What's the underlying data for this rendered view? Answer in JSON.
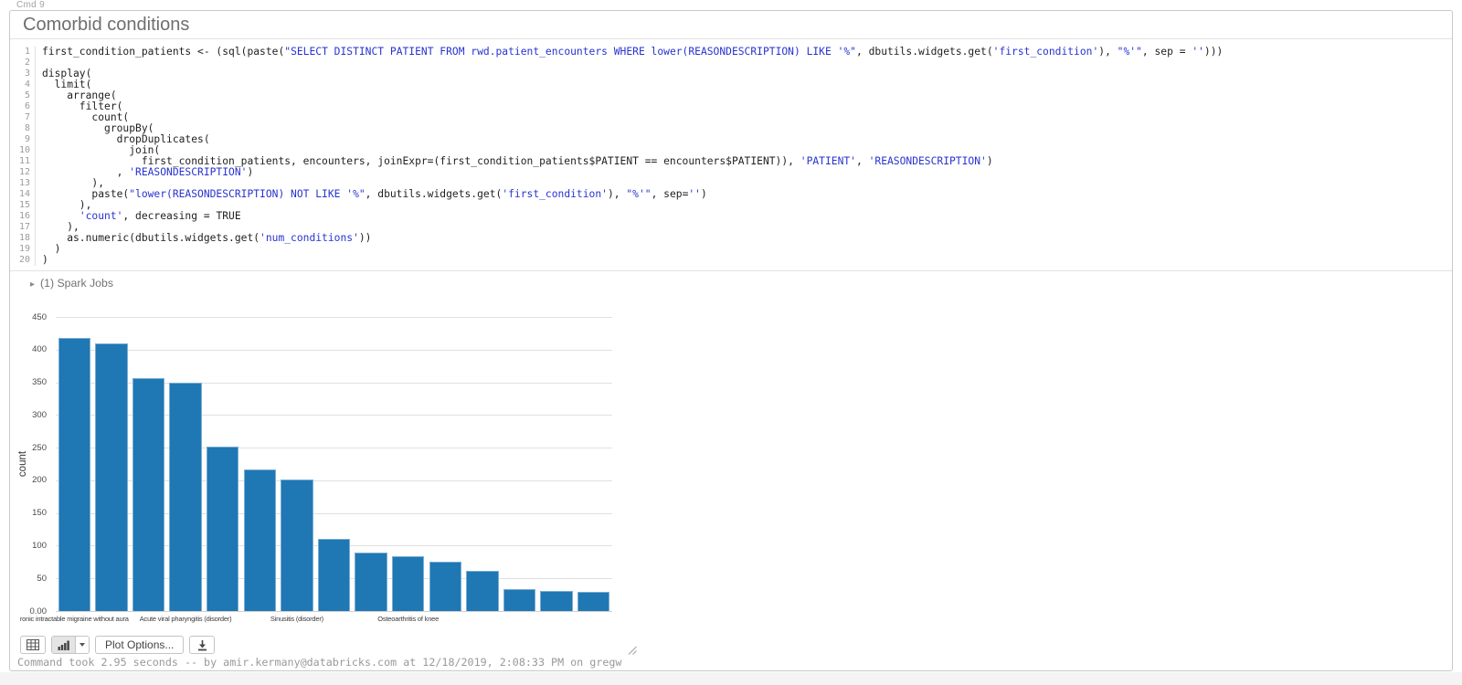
{
  "cell": {
    "cmd_label": "Cmd 9",
    "title": "Comorbid conditions",
    "spark_jobs_label": "(1) Spark Jobs",
    "status_line": "Command took 2.95 seconds -- by amir.kermany@databricks.com at 12/18/2019, 2:08:33 PM on gregw"
  },
  "toolbar": {
    "plot_options_label": "Plot Options..."
  },
  "code": {
    "lines": [
      {
        "n": 1,
        "parts": [
          [
            "p",
            "first_condition_patients <- (sql(paste("
          ],
          [
            "s",
            "\"SELECT DISTINCT PATIENT FROM rwd.patient_encounters WHERE lower(REASONDESCRIPTION) LIKE '%\""
          ],
          [
            "p",
            ", dbutils.widgets.get("
          ],
          [
            "s",
            "'first_condition'"
          ],
          [
            "p",
            "), "
          ],
          [
            "s",
            "\"%'\""
          ],
          [
            "p",
            ", sep = "
          ],
          [
            "s",
            "''"
          ],
          [
            "p",
            ")))"
          ]
        ]
      },
      {
        "n": 2,
        "parts": []
      },
      {
        "n": 3,
        "parts": [
          [
            "p",
            "display("
          ]
        ]
      },
      {
        "n": 4,
        "parts": [
          [
            "p",
            "  limit("
          ]
        ]
      },
      {
        "n": 5,
        "parts": [
          [
            "p",
            "    arrange("
          ]
        ]
      },
      {
        "n": 6,
        "parts": [
          [
            "p",
            "      filter("
          ]
        ]
      },
      {
        "n": 7,
        "parts": [
          [
            "p",
            "        count("
          ]
        ]
      },
      {
        "n": 8,
        "parts": [
          [
            "p",
            "          groupBy("
          ]
        ]
      },
      {
        "n": 9,
        "parts": [
          [
            "p",
            "            dropDuplicates("
          ]
        ]
      },
      {
        "n": 10,
        "parts": [
          [
            "p",
            "              join("
          ]
        ]
      },
      {
        "n": 11,
        "parts": [
          [
            "p",
            "                first_condition_patients, encounters, joinExpr=(first_condition_patients$PATIENT == encounters$PATIENT)), "
          ],
          [
            "s",
            "'PATIENT'"
          ],
          [
            "p",
            ", "
          ],
          [
            "s",
            "'REASONDESCRIPTION'"
          ],
          [
            "p",
            ")"
          ]
        ]
      },
      {
        "n": 12,
        "parts": [
          [
            "p",
            "            , "
          ],
          [
            "s",
            "'REASONDESCRIPTION'"
          ],
          [
            "p",
            ")"
          ]
        ]
      },
      {
        "n": 13,
        "parts": [
          [
            "p",
            "        ),"
          ]
        ]
      },
      {
        "n": 14,
        "parts": [
          [
            "p",
            "        paste("
          ],
          [
            "s",
            "\"lower(REASONDESCRIPTION) NOT LIKE '%\""
          ],
          [
            "p",
            ", dbutils.widgets.get("
          ],
          [
            "s",
            "'first_condition'"
          ],
          [
            "p",
            "), "
          ],
          [
            "s",
            "\"%'\""
          ],
          [
            "p",
            ", sep="
          ],
          [
            "s",
            "''"
          ],
          [
            "p",
            ")"
          ]
        ]
      },
      {
        "n": 15,
        "parts": [
          [
            "p",
            "      ),"
          ]
        ]
      },
      {
        "n": 16,
        "parts": [
          [
            "p",
            "      "
          ],
          [
            "s",
            "'count'"
          ],
          [
            "p",
            ", decreasing = TRUE"
          ]
        ]
      },
      {
        "n": 17,
        "parts": [
          [
            "p",
            "    ),"
          ]
        ]
      },
      {
        "n": 18,
        "parts": [
          [
            "p",
            "    as.numeric(dbutils.widgets.get("
          ],
          [
            "s",
            "'num_conditions'"
          ],
          [
            "p",
            "))"
          ]
        ]
      },
      {
        "n": 19,
        "parts": [
          [
            "p",
            "  )"
          ]
        ]
      },
      {
        "n": 20,
        "parts": [
          [
            "p",
            ")"
          ]
        ]
      }
    ]
  },
  "chart_data": {
    "type": "bar",
    "title": "",
    "xlabel": "",
    "ylabel": "count",
    "ylim": [
      0,
      450
    ],
    "grid": true,
    "legend": false,
    "bar_color": "#1f77b4",
    "values": [
      418,
      409,
      357,
      350,
      252,
      217,
      201,
      110,
      89,
      84,
      76,
      62,
      33,
      31,
      29
    ],
    "y_tick_values": [
      450,
      400,
      350,
      300,
      250,
      200,
      150,
      100,
      50,
      0
    ],
    "y_tick_labels": [
      "450",
      "400",
      "350",
      "300",
      "250",
      "200",
      "150",
      "100",
      "50",
      "0.00"
    ],
    "x_tick_labels": [
      {
        "bar_index": 0,
        "label": "ronic intractable migraine without aura"
      },
      {
        "bar_index": 3,
        "label": "Acute viral pharyngitis (disorder)"
      },
      {
        "bar_index": 6,
        "label": "Sinusitis (disorder)"
      },
      {
        "bar_index": 9,
        "label": "Osteoarthritis of knee"
      }
    ]
  }
}
